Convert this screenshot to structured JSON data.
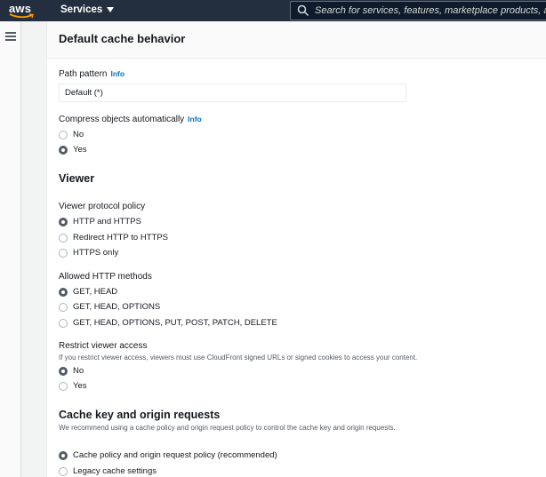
{
  "nav": {
    "logo_text": "aws",
    "services_label": "Services",
    "search_placeholder": "Search for services, features, marketplace products, and docs"
  },
  "page": {
    "title": "Default cache behavior"
  },
  "path_pattern": {
    "label": "Path pattern",
    "info": "Info",
    "value": "Default (*)"
  },
  "compress": {
    "label": "Compress objects automatically",
    "info": "Info",
    "options": [
      {
        "label": "No",
        "checked": false
      },
      {
        "label": "Yes",
        "checked": true
      }
    ]
  },
  "viewer": {
    "title": "Viewer",
    "protocol": {
      "label": "Viewer protocol policy",
      "options": [
        {
          "label": "HTTP and HTTPS",
          "checked": true
        },
        {
          "label": "Redirect HTTP to HTTPS",
          "checked": false
        },
        {
          "label": "HTTPS only",
          "checked": false
        }
      ]
    },
    "methods": {
      "label": "Allowed HTTP methods",
      "options": [
        {
          "label": "GET, HEAD",
          "checked": true
        },
        {
          "label": "GET, HEAD, OPTIONS",
          "checked": false
        },
        {
          "label": "GET, HEAD, OPTIONS, PUT, POST, PATCH, DELETE",
          "checked": false
        }
      ]
    },
    "restrict": {
      "label": "Restrict viewer access",
      "description": "If you restrict viewer access, viewers must use CloudFront signed URLs or signed cookies to access your content.",
      "options": [
        {
          "label": "No",
          "checked": true
        },
        {
          "label": "Yes",
          "checked": false
        }
      ]
    }
  },
  "cache_key": {
    "title": "Cache key and origin requests",
    "description": "We recommend using a cache policy and origin request policy to control the cache key and origin requests.",
    "options": [
      {
        "label": "Cache policy and origin request policy (recommended)",
        "checked": true
      },
      {
        "label": "Legacy cache settings",
        "checked": false
      }
    ]
  },
  "colors": {
    "nav_bg": "#232f3e",
    "link": "#0073bb",
    "page_bg": "#f2f3f3"
  }
}
